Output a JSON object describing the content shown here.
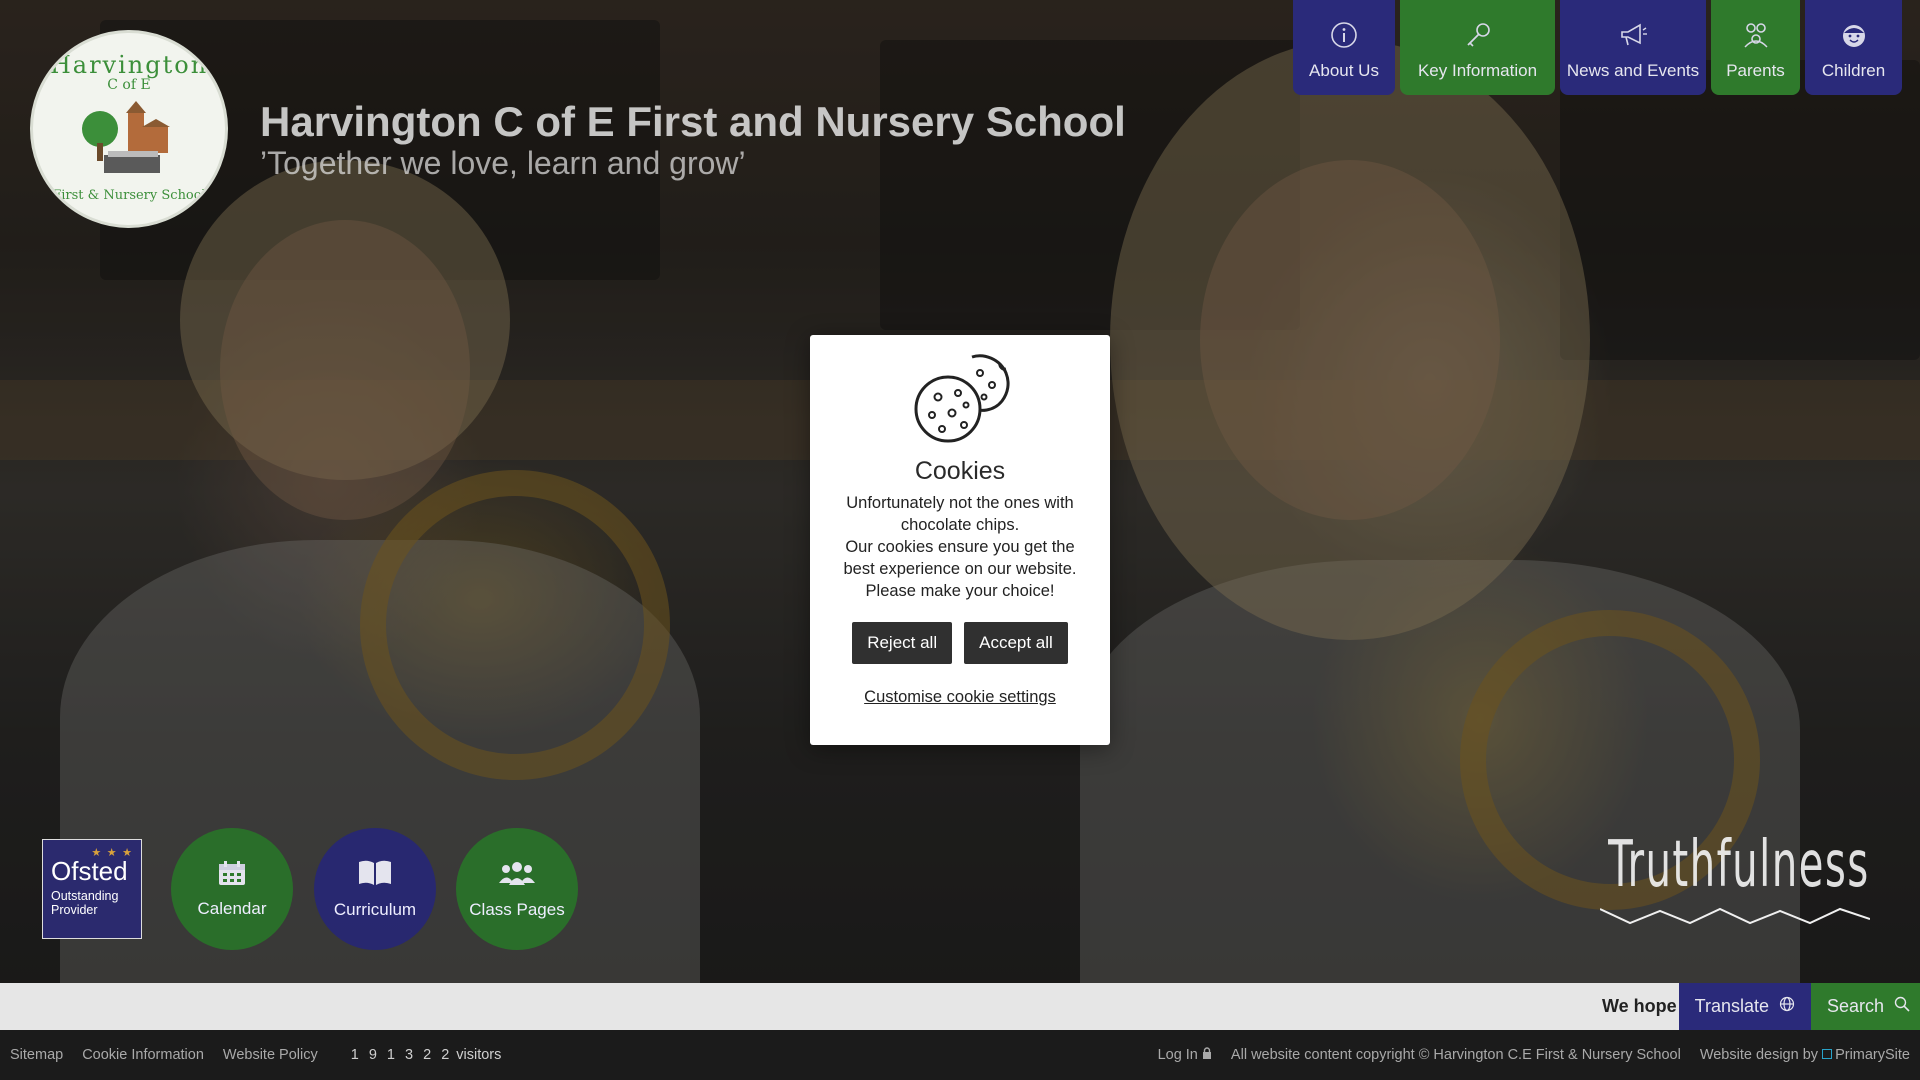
{
  "school": {
    "name": "Harvington C of E First and Nursery School",
    "motto": "’Together we love, learn and grow’",
    "logo": {
      "title": "Harvington",
      "sub": "C of E",
      "bottom": "First & Nursery School"
    }
  },
  "topnav": [
    {
      "label": "About Us",
      "icon": "info-icon",
      "color": "#2a2a7a"
    },
    {
      "label": "Key Information",
      "icon": "key-icon",
      "color": "#2f7a2c"
    },
    {
      "label": "News and Events",
      "icon": "megaphone-icon",
      "color": "#2a2a7a"
    },
    {
      "label": "Parents",
      "icon": "parents-icon",
      "color": "#2f7a2c"
    },
    {
      "label": "Children",
      "icon": "child-icon",
      "color": "#2a2a7a"
    }
  ],
  "cookie": {
    "icon": "cookie-icon",
    "title": "Cookies",
    "lines": [
      "Unfortunately not the ones with chocolate chips.",
      "Our cookies ensure you get the best experience on our website.",
      "Please make your choice!"
    ],
    "reject": "Reject all",
    "accept": "Accept all",
    "customise": "Customise cookie settings"
  },
  "ofsted": {
    "brand": "Ofsted",
    "rating": "Outstanding Provider"
  },
  "quicklinks": [
    {
      "label": "Calendar",
      "icon": "calendar-icon"
    },
    {
      "label": "Curriculum",
      "icon": "book-icon"
    },
    {
      "label": "Class Pages",
      "icon": "group-icon"
    }
  ],
  "value_word": "Truthfulness",
  "ticker": {
    "text": "We hope",
    "translate": "Translate",
    "search": "Search"
  },
  "footer": {
    "links": [
      "Sitemap",
      "Cookie Information",
      "Website Policy"
    ],
    "visitor_count": "1 9 1 3 2 2",
    "visitors_label": "visitors",
    "login": "Log In",
    "copyright": "All website content copyright © Harvington C.E First & Nursery School",
    "design_prefix": "Website design by",
    "designer": "PrimarySite"
  },
  "colors": {
    "purple": "#2a2a7a",
    "green": "#2f7a2c"
  }
}
